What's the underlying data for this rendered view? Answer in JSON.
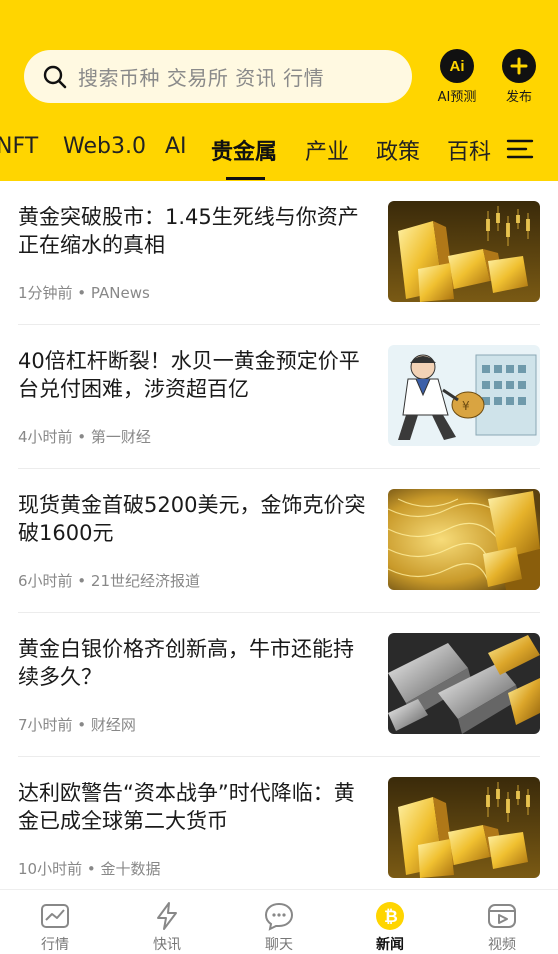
{
  "search": {
    "placeholder": "搜索币种 交易所 资讯 行情"
  },
  "header_actions": [
    {
      "label": "AI预测",
      "icon": "ai-icon"
    },
    {
      "label": "发布",
      "icon": "plus-icon"
    }
  ],
  "tabs": [
    {
      "label": "NFT",
      "active": false
    },
    {
      "label": "Web3.0",
      "active": false
    },
    {
      "label": "AI",
      "active": false
    },
    {
      "label": "贵金属",
      "active": true
    },
    {
      "label": "产业",
      "active": false
    },
    {
      "label": "政策",
      "active": false
    },
    {
      "label": "百科",
      "active": false
    }
  ],
  "news": [
    {
      "title": "黄金突破股市：1.45生死线与你资产正在缩水的真相",
      "meta": "1分钟前 • PANews",
      "thumb": "gold-bars-chart"
    },
    {
      "title": "40倍杠杆断裂！水贝一黄金预定价平台兑付困难，涉资超百亿",
      "meta": "4小时前 • 第一财经",
      "thumb": "cartoon-runner"
    },
    {
      "title": "现货黄金首破5200美元，金饰克价突破1600元",
      "meta": "6小时前 • 21世纪经济报道",
      "thumb": "gold-jewelry"
    },
    {
      "title": "黄金白银价格齐创新高，牛市还能持续多久？",
      "meta": "7小时前 • 财经网",
      "thumb": "silver-gold-bars"
    },
    {
      "title": "达利欧警告“资本战争”时代降临：黄金已成全球第二大货币",
      "meta": "10小时前 • 金十数据",
      "thumb": "gold-bars-chart"
    }
  ],
  "bottom_nav": [
    {
      "label": "行情",
      "icon": "chart-icon",
      "active": false
    },
    {
      "label": "快讯",
      "icon": "lightning-icon",
      "active": false
    },
    {
      "label": "聊天",
      "icon": "chat-icon",
      "active": false
    },
    {
      "label": "新闻",
      "icon": "bitcoin-icon",
      "active": true
    },
    {
      "label": "视频",
      "icon": "video-icon",
      "active": false
    }
  ],
  "colors": {
    "brand_yellow": "#FFD500",
    "search_bg": "#FFF9E1",
    "text_primary": "#1a1a1a",
    "text_secondary": "#888888"
  }
}
